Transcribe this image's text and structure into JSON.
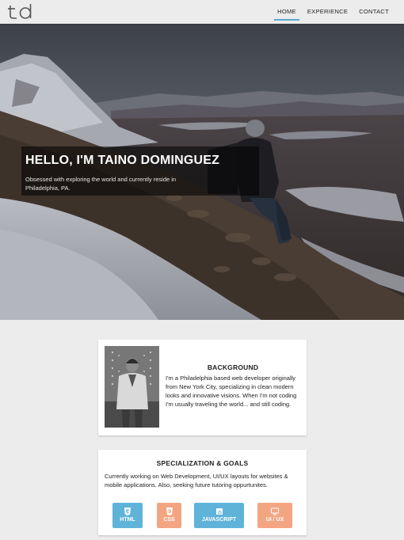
{
  "nav": {
    "logo": "td",
    "links": [
      {
        "label": "HOME",
        "active": true
      },
      {
        "label": "EXPERIENCE",
        "active": false
      },
      {
        "label": "CONTACT",
        "active": false
      }
    ]
  },
  "hero": {
    "title": "HELLO, I'M TAINO DOMINGUEZ",
    "subtitle": "Obsessed with exploring the world and currently reside in Philadelphia, PA."
  },
  "background": {
    "title": "BACKGROUND",
    "text": "I'm a Philadelphia based web developer originally from New York City, specializing in clean modern looks and innovative visions. When I'm not coding I'm usually traveling the world... and still coding."
  },
  "specialization": {
    "title": "SPECIALIZATION & GOALS",
    "text": "Currently working on Web Development, UI/UX layouts for websites & mobile applications. Also, seeking future tutoring oppurtunites.",
    "skills": [
      {
        "label": "HTML",
        "icon": "html5-icon",
        "color": "#5fb3d9"
      },
      {
        "label": "CSS",
        "icon": "css3-icon",
        "color": "#f3a582"
      },
      {
        "label": "JAVASCRIPT",
        "icon": "js-icon",
        "color": "#5fb3d9"
      },
      {
        "label": "UI / UX",
        "icon": "monitor-icon",
        "color": "#f3a582"
      }
    ]
  },
  "colors": {
    "accent": "#5aa9cf",
    "page_bg": "#ececec"
  }
}
